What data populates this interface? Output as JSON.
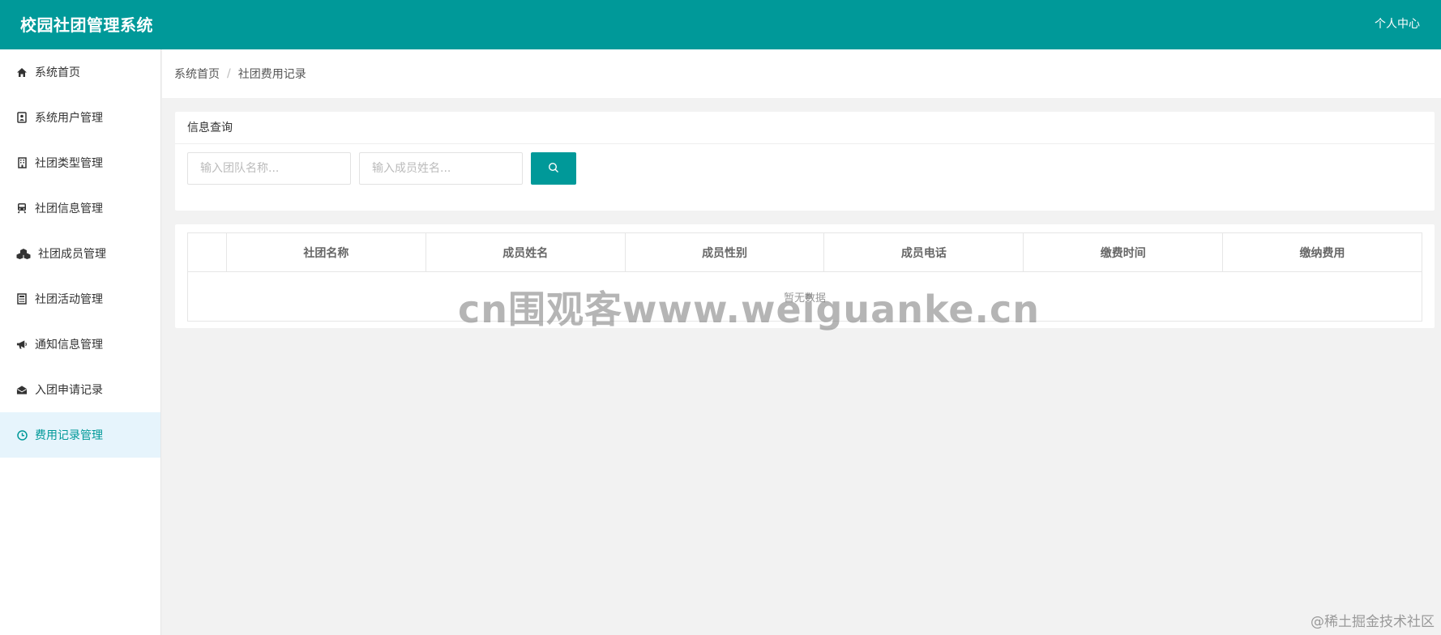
{
  "header": {
    "app_title": "校园社团管理系统",
    "user_center": "个人中心"
  },
  "sidebar": {
    "items": [
      {
        "label": "系统首页",
        "icon": "home-icon"
      },
      {
        "label": "系统用户管理",
        "icon": "user-card-icon"
      },
      {
        "label": "社团类型管理",
        "icon": "building-icon"
      },
      {
        "label": "社团信息管理",
        "icon": "train-icon"
      },
      {
        "label": "社团成员管理",
        "icon": "cubes-icon"
      },
      {
        "label": "社团活动管理",
        "icon": "calculator-icon"
      },
      {
        "label": "通知信息管理",
        "icon": "bullhorn-icon"
      },
      {
        "label": "入团申请记录",
        "icon": "envelope-open-icon"
      },
      {
        "label": "费用记录管理",
        "icon": "clock-icon",
        "active": true
      }
    ]
  },
  "breadcrumb": {
    "home": "系统首页",
    "separator": "/",
    "current": "社团费用记录"
  },
  "search": {
    "title": "信息查询",
    "team_placeholder": "输入团队名称...",
    "member_placeholder": "输入成员姓名..."
  },
  "table": {
    "columns": [
      "社团名称",
      "成员姓名",
      "成员性别",
      "成员电话",
      "缴费时间",
      "缴纳费用"
    ],
    "empty_text": "暂无数据"
  },
  "watermark": "cn围观客www.weiguanke.cn",
  "footer_mark": "@稀土掘金技术社区",
  "colors": {
    "primary": "#009999",
    "active_bg": "#e6f4fc"
  }
}
